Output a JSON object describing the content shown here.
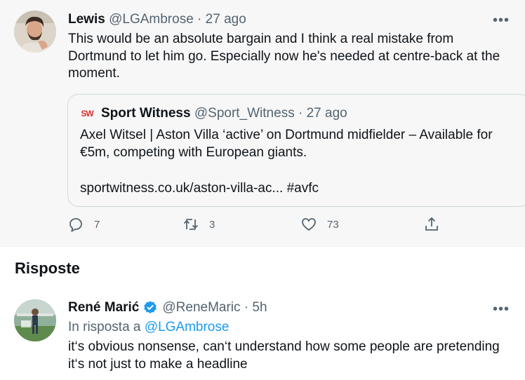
{
  "main_tweet": {
    "name": "Lewis",
    "handle": "@LGAmbrose",
    "separator": "·",
    "time": "27 ago",
    "more": "•••",
    "text": "This would be an absolute bargain and I think a real mistake from Dortmund to let him go. Especially now he's needed at centre-back at the moment.",
    "quote": {
      "logo_text": "SW",
      "name": "Sport Witness",
      "handle": "@Sport_Witness",
      "separator": "·",
      "time": "27 ago",
      "text": "Axel Witsel | Aston Villa ‘active’ on Dortmund midfielder – Available for €5m, competing with European giants.",
      "link": "sportwitness.co.uk/aston-villa-ac... #avfc"
    },
    "actions": {
      "reply_count": "7",
      "retweet_count": "3",
      "like_count": "73"
    }
  },
  "replies_section": {
    "title": "Risposte"
  },
  "reply": {
    "name": "René Marić",
    "handle": "@ReneMaric",
    "separator": "·",
    "time": "5h",
    "more": "•••",
    "reply_prefix": "In risposta a",
    "reply_to": "@LGAmbrose",
    "text": "it‘s obvious nonsense, can‘t understand how some people are pretending it‘s not just to make a headline"
  },
  "colors": {
    "accent": "#1d9bf0",
    "muted": "#536471",
    "text": "#0f1419",
    "main_bg": "#f7f7f7",
    "sw_red": "#d6332b"
  },
  "icons": {
    "reply": "reply-icon",
    "retweet": "retweet-icon",
    "like": "heart-icon",
    "share": "share-icon",
    "verified": "verified-badge-icon",
    "more": "more-icon"
  }
}
